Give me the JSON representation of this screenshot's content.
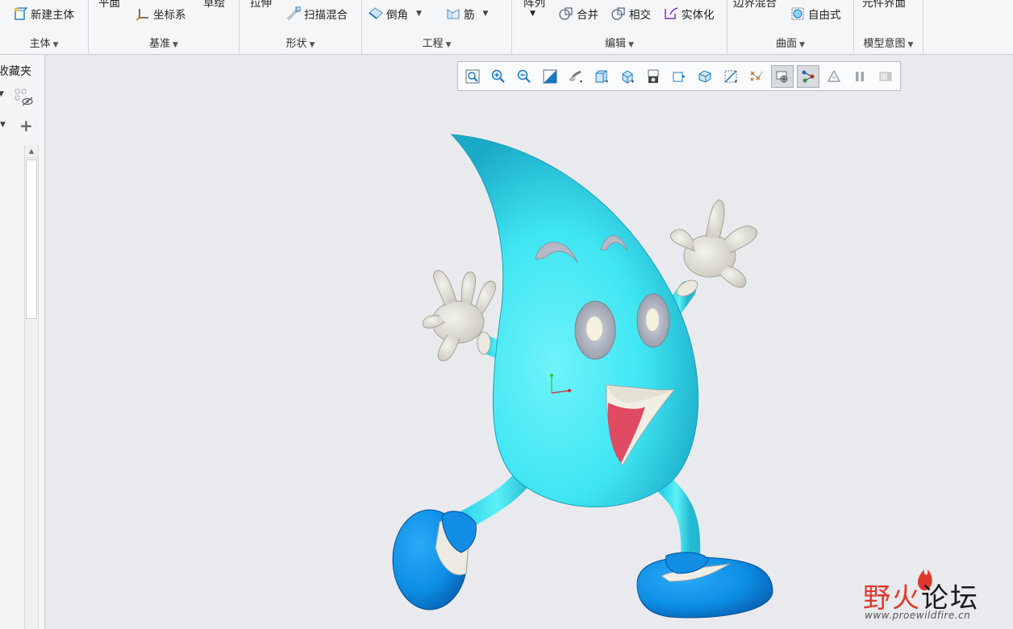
{
  "ribbon": {
    "groups": [
      {
        "label": "主体"
      },
      {
        "label": "基准"
      },
      {
        "label": "形状"
      },
      {
        "label": "工程"
      },
      {
        "label": "编辑"
      },
      {
        "label": "曲面"
      },
      {
        "label": "模型意图"
      }
    ],
    "new_body": "新建主体",
    "plane_cut": "平面",
    "sketch_cut": "草绘",
    "csys": "坐标系",
    "extrude_cut": "拉伸",
    "sweep_blend": "扫描混合",
    "chamfer": "倒角",
    "rib": "筋",
    "pattern_cut": "阵列",
    "merge": "合并",
    "intersect": "相交",
    "solidify": "实体化",
    "boundary_blend_cut": "边界混合",
    "freestyle": "自由式",
    "component_interface_cut": "元件界面"
  },
  "left_panel": {
    "title": "收藏夹"
  },
  "view_toolbar": {
    "buttons": [
      "refit-icon",
      "zoom-in-icon",
      "zoom-out-icon",
      "repaint-icon",
      "display-style-icon",
      "saved-orientations-icon",
      "named-views-icon",
      "view-manager-icon",
      "perspective-icon",
      "section-icon",
      "datum-display-icon",
      "annotation-display-icon",
      "spin-center-icon",
      "appearance-icon",
      "pause-icon",
      "hidden-line-icon"
    ],
    "active": [
      "annotation-display-icon",
      "spin-center-icon"
    ]
  },
  "watermark": {
    "cn_a": "野火",
    "cn_b": "论坛",
    "url": "www.proewildfire.cn"
  },
  "colors": {
    "body": "#3fe6f2",
    "body_shadow": "#18a9c3",
    "shoe": "#0d8fe6",
    "glove": "#e6e4da",
    "eye_ring": "#b3b7c4",
    "mouth": "#e04a62",
    "accent": "#1a78c2"
  }
}
